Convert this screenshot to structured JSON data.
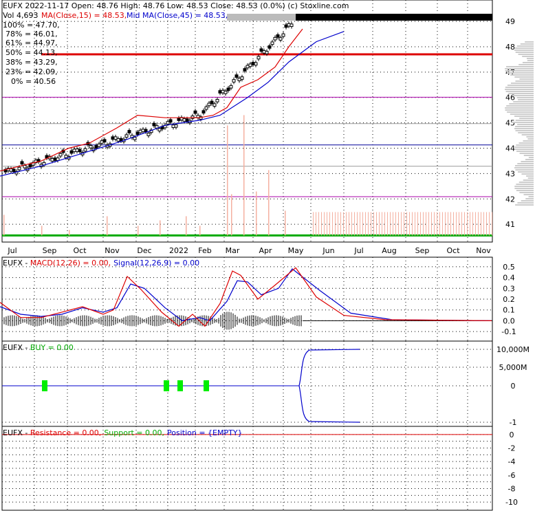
{
  "header": {
    "ticker": "EUFX",
    "line1": "EUFX  2022-11-17 Open: 48.76  High: 48.76  Low: 48.53  Close: 48.53 (0.0%)  (c) Stoxline.com",
    "vol_text": "Vol 4,693",
    "ma15_text": "MA(Close,15) = 48.53,",
    "ma45_text": "Mid MA(Close,45) = 48.53,"
  },
  "fib_levels": [
    {
      "label": "100% = 47.70,",
      "value": 47.7,
      "color": "#dd0000"
    },
    {
      "label": "78% = 46.01,",
      "value": 46.01,
      "color": "#aa00aa"
    },
    {
      "label": "61% = 44.97,",
      "value": 44.97,
      "color": "#999999"
    },
    {
      "label": "50% = 44.13,",
      "value": 44.13,
      "color": "#000099"
    },
    {
      "label": "38% = 43.29,",
      "value": 43.29,
      "color": "#999999"
    },
    {
      "label": "23% = 42.09,",
      "value": 42.09,
      "color": "#aa00aa"
    },
    {
      "label": "0% = 40.56",
      "value": 40.56,
      "color": "#009900"
    }
  ],
  "macd_header": {
    "name": "EUFX - ",
    "macd": "MACD(12,26) = 0.00,",
    "signal": "Signal(12,26,9) = 0.00"
  },
  "buy_header": {
    "name": "EUFX - ",
    "buy": "BUY = 0.00"
  },
  "res_header": {
    "name": "EUFX - ",
    "res": "Resistance = 0.00,",
    "sup": "Support = 0.00,",
    "pos": "Position = {EMPTY}"
  },
  "colors": {
    "red": "#dd0000",
    "blue": "#0000cc",
    "green": "#00aa00",
    "magenta": "#aa00aa",
    "gray": "#999999",
    "volume": "#f4b0a0"
  },
  "chart_data": [
    {
      "type": "line",
      "title": "EUFX price",
      "x_labels": [
        "Jul",
        "Sep",
        "Oct",
        "Nov",
        "Dec",
        "2022",
        "Feb",
        "Mar",
        "Apr",
        "May",
        "Jun",
        "Jul",
        "Aug",
        "Sep",
        "Oct",
        "Nov"
      ],
      "y_ticks": [
        41,
        42,
        43,
        44,
        45,
        46,
        47,
        48,
        49
      ],
      "ylim": [
        40.3,
        49.3
      ],
      "ma_points": [
        [
          0,
          42.9
        ],
        [
          60,
          43.3
        ],
        [
          120,
          43.8
        ],
        [
          180,
          44.3
        ],
        [
          240,
          44.9
        ],
        [
          290,
          45.1
        ],
        [
          320,
          45.3
        ],
        [
          360,
          46.0
        ],
        [
          390,
          46.6
        ],
        [
          420,
          47.4
        ],
        [
          460,
          48.2
        ],
        [
          500,
          48.6
        ]
      ],
      "ma15_points": [
        [
          0,
          43.1
        ],
        [
          30,
          43.3
        ],
        [
          60,
          43.5
        ],
        [
          100,
          44.0
        ],
        [
          130,
          44.2
        ],
        [
          170,
          44.8
        ],
        [
          200,
          45.3
        ],
        [
          240,
          45.2
        ],
        [
          290,
          45.2
        ],
        [
          310,
          45.3
        ],
        [
          330,
          45.6
        ],
        [
          350,
          46.4
        ],
        [
          375,
          46.7
        ],
        [
          400,
          47.2
        ],
        [
          420,
          48.0
        ],
        [
          440,
          48.7
        ]
      ],
      "hline_values": [
        46.01,
        44.97,
        44.13,
        43.29,
        42.09
      ]
    },
    {
      "type": "line",
      "title": "MACD(12,26)",
      "y_ticks": [
        0.5,
        0.4,
        0.3,
        0.2,
        0.1,
        0.0,
        -0.1
      ],
      "ylim": [
        -0.15,
        0.55
      ],
      "macd": [
        [
          0,
          0.17
        ],
        [
          30,
          0.03
        ],
        [
          60,
          0.03
        ],
        [
          90,
          0.08
        ],
        [
          120,
          0.13
        ],
        [
          150,
          0.06
        ],
        [
          165,
          0.1
        ],
        [
          185,
          0.41
        ],
        [
          205,
          0.29
        ],
        [
          235,
          0.08
        ],
        [
          260,
          -0.05
        ],
        [
          280,
          0.06
        ],
        [
          298,
          -0.05
        ],
        [
          320,
          0.16
        ],
        [
          338,
          0.46
        ],
        [
          350,
          0.42
        ],
        [
          375,
          0.2
        ],
        [
          400,
          0.33
        ],
        [
          430,
          0.49
        ],
        [
          460,
          0.22
        ],
        [
          500,
          0.05
        ],
        [
          560,
          0.01
        ],
        [
          715,
          0.0
        ]
      ],
      "signal": [
        [
          0,
          0.13
        ],
        [
          30,
          0.06
        ],
        [
          60,
          0.04
        ],
        [
          90,
          0.06
        ],
        [
          120,
          0.12
        ],
        [
          150,
          0.08
        ],
        [
          170,
          0.12
        ],
        [
          190,
          0.34
        ],
        [
          210,
          0.3
        ],
        [
          240,
          0.12
        ],
        [
          265,
          0.0
        ],
        [
          290,
          0.03
        ],
        [
          305,
          0.0
        ],
        [
          330,
          0.18
        ],
        [
          345,
          0.37
        ],
        [
          360,
          0.36
        ],
        [
          380,
          0.24
        ],
        [
          405,
          0.3
        ],
        [
          425,
          0.48
        ],
        [
          465,
          0.28
        ],
        [
          510,
          0.07
        ],
        [
          570,
          0.01
        ],
        [
          715,
          0.0
        ]
      ]
    },
    {
      "type": "line",
      "title": "BUY",
      "y_ticks": [
        "10,000M",
        "5,000M",
        "0",
        "-1"
      ],
      "buy_markers_x": [
        65,
        242,
        262,
        300
      ]
    },
    {
      "type": "line",
      "title": "Resistance / Support / Position",
      "y_ticks": [
        0,
        -2,
        -4,
        -6,
        -8,
        -10
      ],
      "ylim": [
        -11,
        1
      ]
    }
  ]
}
